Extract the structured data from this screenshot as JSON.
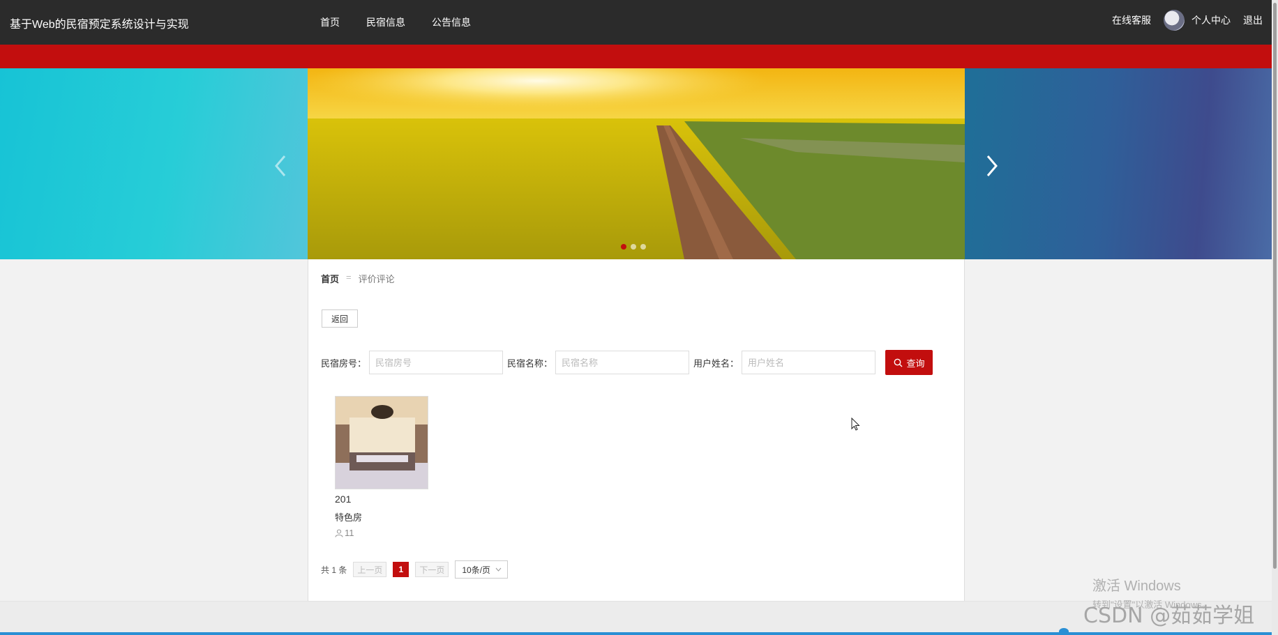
{
  "header": {
    "site_title": "基于Web的民宿预定系统设计与实现",
    "nav": [
      "首页",
      "民宿信息",
      "公告信息"
    ],
    "right": {
      "service": "在线客服",
      "profile": "个人中心",
      "logout": "退出"
    }
  },
  "banner": {
    "slide_count": 3,
    "active_slide": 0
  },
  "breadcrumb": {
    "home": "首页",
    "separator": "=",
    "current": "评价评论"
  },
  "back_label": "返回",
  "search": {
    "fields": [
      {
        "label": "民宿房号：",
        "placeholder": "民宿房号"
      },
      {
        "label": "民宿名称：",
        "placeholder": "民宿名称"
      },
      {
        "label": "用户姓名：",
        "placeholder": "用户姓名"
      }
    ],
    "button": "查询"
  },
  "items": [
    {
      "room_number": "201",
      "room_type": "特色房",
      "count": "11"
    }
  ],
  "pagination": {
    "total": "共 1 条",
    "prev": "上一页",
    "current_page": "1",
    "next": "下一页",
    "page_size": "10条/页"
  },
  "overlay": {
    "activate_title": "激活 Windows",
    "activate_sub": "转到\"设置\"以激活 Windows。",
    "csdn": "CSDN @茹茹学姐"
  },
  "colors": {
    "nav_bg": "#2b2b2b",
    "accent": "#c20e0e"
  }
}
